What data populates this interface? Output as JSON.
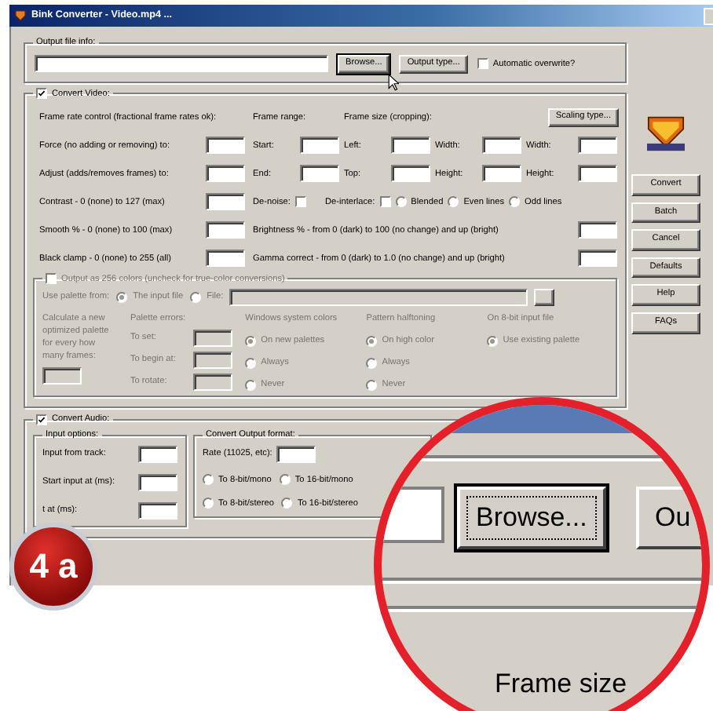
{
  "window": {
    "title": "Bink Converter - Video.mp4 ..."
  },
  "output_file_info": {
    "label": "Output file info:",
    "browse_button": "Browse...",
    "output_type_button": "Output type...",
    "auto_overwrite": {
      "label": "Automatic overwrite?",
      "checked": false
    }
  },
  "convert_video": {
    "label": "Convert Video:",
    "checked": true,
    "frame_rate": {
      "heading": "Frame rate control (fractional frame rates ok):",
      "force": "Force (no adding or removing) to:",
      "adjust": "Adjust (adds/removes frames) to:"
    },
    "frame_range": {
      "heading": "Frame range:",
      "start": "Start:",
      "end": "End:"
    },
    "frame_size": {
      "heading": "Frame size (cropping):",
      "left": "Left:",
      "top": "Top:",
      "width": "Width:",
      "height": "Height:"
    },
    "scaling": {
      "button": "Scaling type...",
      "width": "Width:",
      "height": "Height:"
    },
    "contrast": "Contrast - 0 (none) to 127 (max)",
    "denoise": {
      "label": "De-noise:",
      "checked": false
    },
    "deinterlace": {
      "label": "De-interlace:",
      "checked": false,
      "modes": [
        {
          "label": "Blended",
          "selected": false
        },
        {
          "label": "Even lines",
          "selected": false
        },
        {
          "label": "Odd lines",
          "selected": false
        }
      ]
    },
    "smooth": "Smooth % - 0 (none) to 100 (max)",
    "brightness": "Brightness % - from 0 (dark) to 100 (no change) and up (bright)",
    "black_clamp": "Black clamp - 0 (none) to 255 (all)",
    "gamma": "Gamma correct - from 0 (dark) to 1.0 (no change) and up (bright)",
    "palette_output": {
      "label": "Output as 256 colors (uncheck for true-color conversions)",
      "checked": false,
      "disabled": true,
      "use_palette_from": "Use palette from:",
      "sources": [
        {
          "label": "The input file",
          "selected": true
        },
        {
          "label": "File:",
          "selected": false
        }
      ],
      "calculate": "Calculate a new optimized palette for every how many frames:",
      "palette_errors": {
        "heading": "Palette errors:",
        "fields": [
          "To set:",
          "To begin at:",
          "To rotate:"
        ]
      },
      "option_groups": [
        {
          "heading": "Windows system colors",
          "options": [
            {
              "label": "On new palettes",
              "selected": true
            },
            {
              "label": "Always",
              "selected": false
            },
            {
              "label": "Never",
              "selected": false
            }
          ]
        },
        {
          "heading": "Pattern halftoning",
          "options": [
            {
              "label": "On high color",
              "selected": true
            },
            {
              "label": "Always",
              "selected": false
            },
            {
              "label": "Never",
              "selected": false
            }
          ]
        },
        {
          "heading": "On 8-bit input file",
          "options": [
            {
              "label": "Use existing palette",
              "selected": true
            }
          ]
        }
      ]
    }
  },
  "convert_audio": {
    "label": "Convert Audio:",
    "checked": true,
    "input_options": {
      "heading": "Input options:",
      "fields": [
        "Input from track:",
        "Start input at (ms):",
        "t at (ms):"
      ]
    },
    "output_format": {
      "heading": "Convert Output format:",
      "rate": "Rate (11025, etc):",
      "formats": [
        {
          "label": "To 8-bit/mono",
          "selected": false
        },
        {
          "label": "To 16-bit/mono",
          "selected": false
        },
        {
          "label": "To 8-bit/stereo",
          "selected": false
        },
        {
          "label": "To 16-bit/stereo",
          "selected": false
        }
      ]
    }
  },
  "side_buttons": [
    "Convert",
    "Batch",
    "Cancel",
    "Defaults",
    "Help",
    "FAQs"
  ],
  "magnifier": {
    "browse_button": "Browse...",
    "next_button": "Ou",
    "label": "Frame size"
  },
  "badge": "4 a"
}
